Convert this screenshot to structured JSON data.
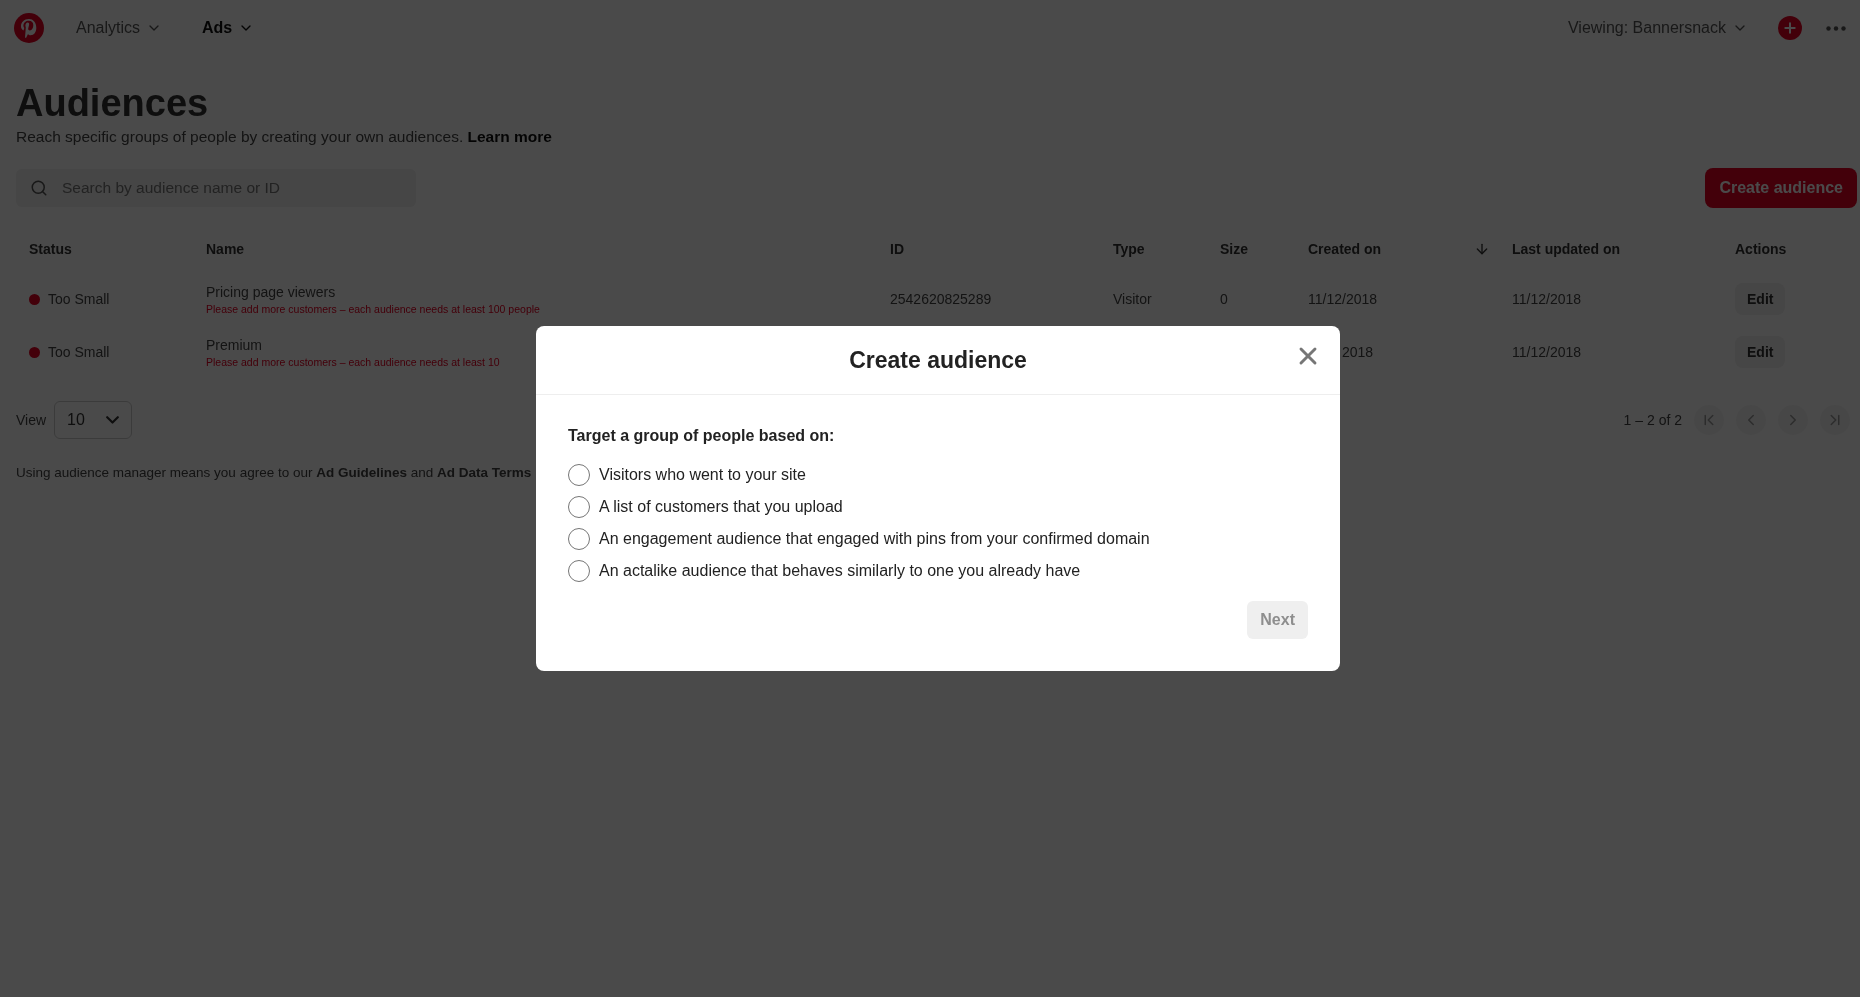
{
  "nav": {
    "items": [
      {
        "label": "Analytics",
        "selected": false
      },
      {
        "label": "Ads",
        "selected": true
      }
    ],
    "account": "Viewing: Bannersnack"
  },
  "header": {
    "title": "Audiences",
    "subtitle": "Reach specific groups of people by creating your own audiences.",
    "link": "Learn more"
  },
  "search": {
    "placeholder": "Search by audience name or ID"
  },
  "create_button": "Create audience",
  "table": {
    "columns": [
      "Status",
      "Name",
      "ID",
      "Type",
      "Size",
      "Created on",
      "Last updated on",
      "Actions"
    ],
    "rows": [
      {
        "status": "Too Small",
        "name": "Pricing page viewers",
        "warning": "Please add more customers – each audience needs at least 100 people",
        "id": "2542620825289",
        "type": "Visitor",
        "size": "0",
        "created_on": "11/12/2018",
        "created_cut": false,
        "last_updated": "11/12/2018",
        "action": "Edit"
      },
      {
        "status": "Too Small",
        "name": "Premium",
        "warning": "Please add more customers – each audience needs at least 10",
        "created_on": "2018",
        "created_cut": true,
        "last_updated": "11/12/2018",
        "action": "Edit"
      }
    ]
  },
  "view": {
    "label": "View",
    "value": "10"
  },
  "pagination": {
    "range": "1 – 2 of 2"
  },
  "footer": {
    "text": "Using audience manager means you agree to our **Ad Guidelines** and **Ad Data Terms**"
  },
  "modal": {
    "title": "Create audience",
    "prompt": "Target a group of people based on:",
    "options": [
      {
        "label": "Visitors who went to your site",
        "selected": false
      },
      {
        "label": "A list of customers that you upload",
        "selected": false
      },
      {
        "label": "An engagement audience that engaged with pins from your confirmed domain",
        "selected": false
      },
      {
        "label": "An actalike audience that behaves similarly to one you already have",
        "selected": false
      }
    ],
    "next": {
      "label": "Next",
      "disabled": true
    }
  }
}
